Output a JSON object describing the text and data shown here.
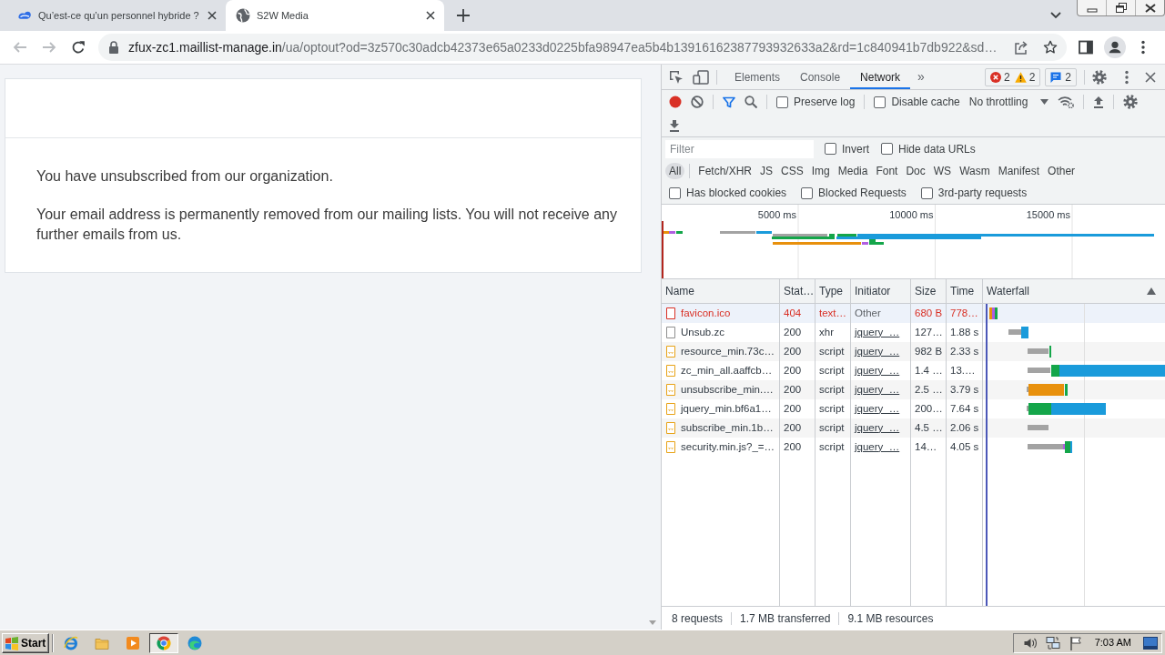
{
  "browser": {
    "tabs": [
      {
        "title": "Qu’est-ce qu’un personnel hybride ?",
        "kind": "swirl",
        "selected": false
      },
      {
        "title": "S2W Media",
        "kind": "globe",
        "selected": true
      }
    ],
    "navigation": {
      "back_disabled": true,
      "forward_disabled": true
    },
    "address": {
      "host": "zfux-zc1.maillist-manage.in",
      "path": "/ua/optout?od=3z570c30adcb42373e65a0233d0225bfa98947ea5b4b13916162387793932633a2&rd=1c840941b7db922&sd…"
    }
  },
  "page": {
    "paragraphs": [
      "You have unsubscribed from our organization.",
      "Your email address is permanently removed from our mailing lists. You will not receive any further emails from us."
    ]
  },
  "devtools": {
    "panel_tabs": [
      {
        "label": "Elements",
        "selected": false
      },
      {
        "label": "Console",
        "selected": false
      },
      {
        "label": "Network",
        "selected": true
      }
    ],
    "more_tabs": "»",
    "issues": {
      "errors": "2",
      "warnings": "2"
    },
    "messages": "2",
    "recording": true,
    "filter_bar_open": true,
    "toolbar_options": [
      {
        "label": "Preserve log",
        "checked": false
      },
      {
        "label": "Disable cache",
        "checked": false
      }
    ],
    "throttling": "No throttling",
    "filter": {
      "placeholder": "Filter"
    },
    "filter_options": [
      {
        "label": "Invert",
        "checked": false
      },
      {
        "label": "Hide data URLs",
        "checked": false
      }
    ],
    "type_filters": [
      {
        "label": "All",
        "selected": true
      },
      {
        "label": "Fetch/XHR",
        "selected": false
      },
      {
        "label": "JS",
        "selected": false
      },
      {
        "label": "CSS",
        "selected": false
      },
      {
        "label": "Img",
        "selected": false
      },
      {
        "label": "Media",
        "selected": false
      },
      {
        "label": "Font",
        "selected": false
      },
      {
        "label": "Doc",
        "selected": false
      },
      {
        "label": "WS",
        "selected": false
      },
      {
        "label": "Wasm",
        "selected": false
      },
      {
        "label": "Manifest",
        "selected": false
      },
      {
        "label": "Other",
        "selected": false
      }
    ],
    "request_options": [
      {
        "label": "Has blocked cookies",
        "checked": false
      },
      {
        "label": "Blocked Requests",
        "checked": false
      },
      {
        "label": "3rd-party requests",
        "checked": false
      }
    ],
    "overview": {
      "ticks": [
        "5000 ms",
        "10000 ms",
        "15000 ms"
      ]
    },
    "table": {
      "columns": [
        {
          "label": "Name",
          "sorted": false
        },
        {
          "label": "Stat…",
          "sorted": false
        },
        {
          "label": "Type",
          "sorted": false
        },
        {
          "label": "Initiator",
          "sorted": false
        },
        {
          "label": "Size",
          "sorted": false
        },
        {
          "label": "Time",
          "sorted": false
        },
        {
          "label": "Waterfall",
          "sorted": true
        }
      ],
      "rows": [
        {
          "name": "favicon.ico",
          "status": "404",
          "type": "text…",
          "initiator": "Other",
          "size": "680 B",
          "time": "778…",
          "kind": "other",
          "failed": true,
          "hovered": true,
          "initiator_link": false
        },
        {
          "name": "Unsub.zc",
          "status": "200",
          "type": "xhr",
          "initiator": "jquery_…",
          "size": "127…",
          "time": "1.88 s",
          "kind": "xhr",
          "failed": false,
          "hovered": false,
          "initiator_link": true
        },
        {
          "name": "resource_min.73c…",
          "status": "200",
          "type": "script",
          "initiator": "jquery_…",
          "size": "982 B",
          "time": "2.33 s",
          "kind": "script",
          "failed": false,
          "hovered": false,
          "initiator_link": true
        },
        {
          "name": "zc_min_all.aaffcb…",
          "status": "200",
          "type": "script",
          "initiator": "jquery_…",
          "size": "1.4 …",
          "time": "13.…",
          "kind": "script",
          "failed": false,
          "hovered": false,
          "initiator_link": true
        },
        {
          "name": "unsubscribe_min.…",
          "status": "200",
          "type": "script",
          "initiator": "jquery_…",
          "size": "2.5 …",
          "time": "3.79 s",
          "kind": "script",
          "failed": false,
          "hovered": false,
          "initiator_link": true
        },
        {
          "name": "jquery_min.bf6a1…",
          "status": "200",
          "type": "script",
          "initiator": "jquery_…",
          "size": "200…",
          "time": "7.64 s",
          "kind": "script",
          "failed": false,
          "hovered": false,
          "initiator_link": true
        },
        {
          "name": "subscribe_min.1b…",
          "status": "200",
          "type": "script",
          "initiator": "jquery_…",
          "size": "4.5 …",
          "time": "2.06 s",
          "kind": "script",
          "failed": false,
          "hovered": false,
          "initiator_link": true
        },
        {
          "name": "security.min.js?_=…",
          "status": "200",
          "type": "script",
          "initiator": "jquery_…",
          "size": "14…",
          "time": "4.05 s",
          "kind": "script",
          "failed": false,
          "hovered": false,
          "initiator_link": true
        }
      ]
    },
    "status_bar": [
      "8 requests",
      "1.7 MB transferred",
      "9.1 MB resources"
    ]
  },
  "taskbar": {
    "start": "Start",
    "apps": [
      {
        "kind": "ie",
        "active": false
      },
      {
        "kind": "folder",
        "active": false
      },
      {
        "kind": "media",
        "active": false
      },
      {
        "kind": "chrome",
        "active": true
      },
      {
        "kind": "edge",
        "active": false
      }
    ],
    "clock": "7:03 AM"
  }
}
